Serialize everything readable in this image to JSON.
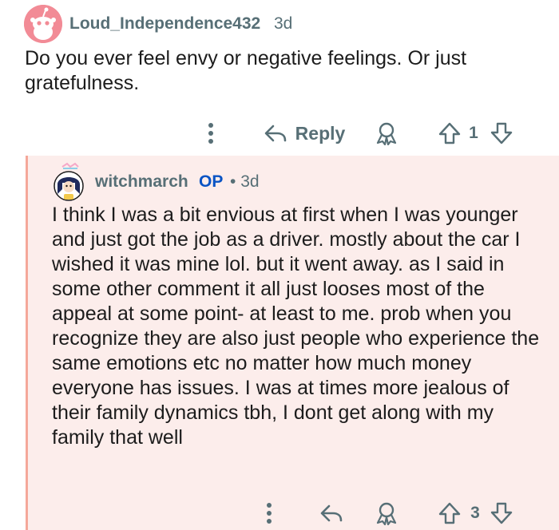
{
  "parent_comment": {
    "username": "Loud_Independence432",
    "age": "3d",
    "body": "Do you ever feel envy or negative feelings. Or just gratefulness.",
    "actions": {
      "reply_label": "Reply",
      "vote_count": "1"
    }
  },
  "reply_comment": {
    "username": "witchmarch",
    "op_badge": "OP",
    "separator": "•",
    "age": "3d",
    "body": "I think I was a bit envious at first when I was younger and just got the job as a driver. mostly about the car I wished it was mine lol. but it went away. as I said in some other comment it all just looses most of the appeal at some point- at least to me. prob when you recognize they are also just people who experience the same emotions etc no matter how much money everyone has issues. I was at times more jealous of their family dynamics tbh, I dont get along with my family that well",
    "actions": {
      "vote_count": "3"
    }
  },
  "colors": {
    "meta_text": "#576f76",
    "body_text": "#1c1c1c",
    "reply_background": "#fcedeb",
    "thread_line": "#f5a89a",
    "op_badge": "#0a54c4",
    "avatar_pink": "#f28b96"
  },
  "icons": [
    "more-options-icon",
    "reply-arrow-icon",
    "award-icon",
    "upvote-icon",
    "downvote-icon",
    "snoo-avatar-icon",
    "user-avatar-icon"
  ]
}
